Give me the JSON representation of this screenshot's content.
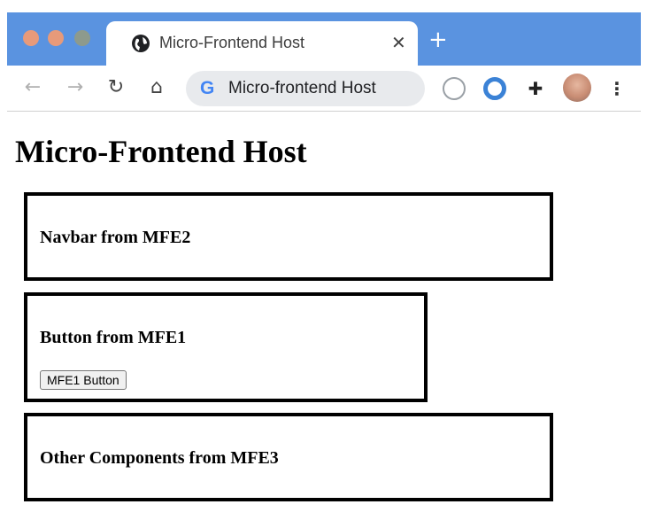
{
  "browser": {
    "tab": {
      "title": "Micro-Frontend Host",
      "icon": "globe-icon",
      "close_glyph": "✕"
    },
    "new_tab_glyph": "+",
    "toolbar": {
      "back_glyph": "←",
      "forward_glyph": "→",
      "reload_glyph": "↻",
      "home_glyph": "⌂",
      "omnibox": {
        "text": "Micro-frontend Host",
        "site_icon": "google-icon",
        "g_glyph": "G"
      },
      "extensions": [
        "cast-extension-icon",
        "ring-extension-icon",
        "puzzle-extensions-icon"
      ],
      "puzzle_glyph": "✚",
      "menu_glyph": "⋮"
    },
    "colors": {
      "tabstrip": "#5a93e0",
      "omnibox_bg": "#e8eaed"
    }
  },
  "page": {
    "title": "Micro-Frontend Host",
    "sections": [
      {
        "heading": "Navbar from MFE2"
      },
      {
        "heading": "Button from MFE1",
        "button_label": "MFE1 Button"
      },
      {
        "heading": "Other Components from MFE3"
      }
    ]
  }
}
